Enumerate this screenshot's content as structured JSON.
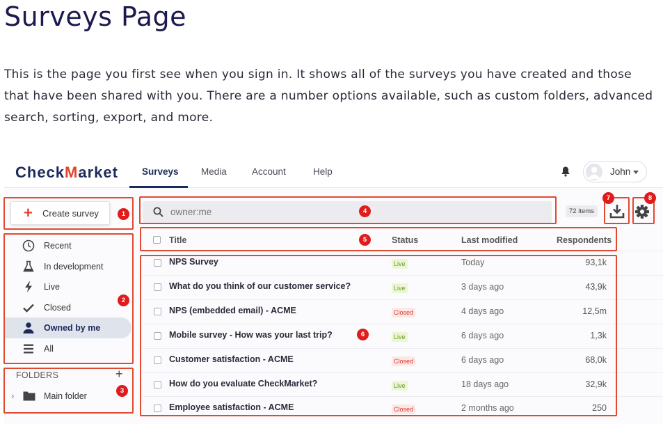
{
  "page": {
    "title": "Surveys Page",
    "intro": "This is the page you first see when you sign in. It shows all of the surveys you have created and those that have been shared with you. There are a number options available, such as custom folders, advanced search, sorting, export, and more."
  },
  "app": {
    "logo_left": "Check",
    "logo_accent": "M",
    "logo_right": "arket",
    "nav": [
      "Surveys",
      "Media",
      "Account",
      "Help"
    ],
    "active_nav": "Surveys",
    "user": "John",
    "create_label": "Create survey",
    "sidebar": [
      {
        "label": "Recent",
        "icon": "clock-icon"
      },
      {
        "label": "In development",
        "icon": "flask-icon"
      },
      {
        "label": "Live",
        "icon": "lightning-icon"
      },
      {
        "label": "Closed",
        "icon": "check-icon"
      },
      {
        "label": "Owned by me",
        "icon": "user-icon",
        "active": true
      },
      {
        "label": "All",
        "icon": "list-icon"
      }
    ],
    "folders_heading": "FOLDERS",
    "folders": [
      {
        "label": "Main folder"
      }
    ],
    "search_value": "owner:me",
    "items_count": "72 items",
    "columns": {
      "title": "Title",
      "status": "Status",
      "modified": "Last modified",
      "respondents": "Respondents"
    },
    "rows": [
      {
        "title": "NPS Survey",
        "status": "Live",
        "modified": "Today",
        "respondents": "93,1k"
      },
      {
        "title": "What do you think of our customer service?",
        "status": "Live",
        "modified": "3 days ago",
        "respondents": "43,9k"
      },
      {
        "title": "NPS (embedded email) - ACME",
        "status": "Closed",
        "modified": "4 days ago",
        "respondents": "12,5m"
      },
      {
        "title": "Mobile survey - How was your last trip?",
        "status": "Live",
        "modified": "6 days ago",
        "respondents": "1,3k"
      },
      {
        "title": "Customer satisfaction - ACME",
        "status": "Closed",
        "modified": "6 days ago",
        "respondents": "68,0k"
      },
      {
        "title": "How do you evaluate CheckMarket?",
        "status": "Live",
        "modified": "18 days ago",
        "respondents": "32,9k"
      },
      {
        "title": "Employee satisfaction - ACME",
        "status": "Closed",
        "modified": "2 months ago",
        "respondents": "250"
      }
    ]
  },
  "annotations": [
    "1",
    "2",
    "3",
    "4",
    "5",
    "6",
    "7",
    "8"
  ],
  "colors": {
    "accent": "#e0452b",
    "brand": "#1d2a5c",
    "annotation": "#e01b1b"
  }
}
